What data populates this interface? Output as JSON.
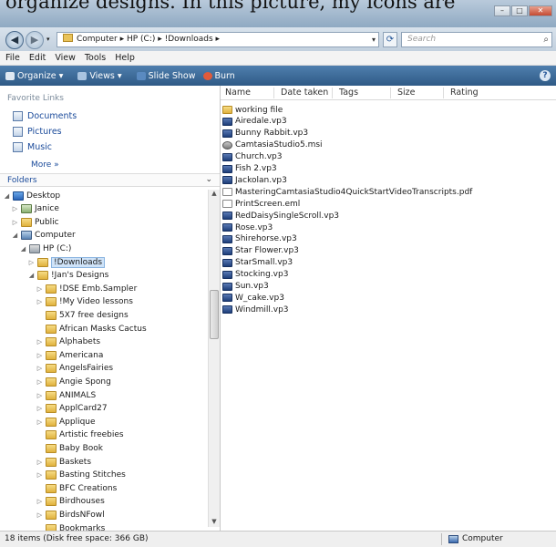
{
  "caption": "organize designs. In this picture, my icons are",
  "address": {
    "breadcrumb": "Computer  ▸  HP (C:)  ▸  !Downloads  ▸",
    "search_placeholder": "Search"
  },
  "menu": [
    "File",
    "Edit",
    "View",
    "Tools",
    "Help"
  ],
  "commands": {
    "organize": "Organize ▾",
    "views": "Views ▾",
    "slideshow": "Slide Show",
    "burn": "Burn"
  },
  "favorites": {
    "title": "Favorite Links",
    "items": [
      "Documents",
      "Pictures",
      "Music"
    ],
    "more": "More »"
  },
  "folders_title": "Folders",
  "tree": [
    {
      "label": "Desktop",
      "icon": "desktop",
      "toggle": "◢"
    },
    {
      "label": "Janice",
      "icon": "user",
      "toggle": "▷"
    },
    {
      "label": "Public",
      "icon": "folder",
      "toggle": "▷"
    },
    {
      "label": "Computer",
      "icon": "computer",
      "toggle": "◢"
    },
    {
      "label": "HP (C:)",
      "icon": "drive",
      "toggle": "◢"
    },
    {
      "label": "!Downloads",
      "icon": "folder",
      "toggle": "▷",
      "selected": true
    },
    {
      "label": "!Jan's Designs",
      "icon": "folder",
      "toggle": "◢"
    },
    {
      "label": "!DSE Emb.Sampler",
      "icon": "folder",
      "toggle": "▷"
    },
    {
      "label": "!My Video lessons",
      "icon": "folder",
      "toggle": "▷"
    },
    {
      "label": "5X7 free designs",
      "icon": "folder",
      "toggle": ""
    },
    {
      "label": "African Masks Cactus",
      "icon": "folder",
      "toggle": ""
    },
    {
      "label": "Alphabets",
      "icon": "folder",
      "toggle": "▷"
    },
    {
      "label": "Americana",
      "icon": "folder",
      "toggle": "▷"
    },
    {
      "label": "AngelsFairies",
      "icon": "folder",
      "toggle": "▷"
    },
    {
      "label": "Angie Spong",
      "icon": "folder",
      "toggle": "▷"
    },
    {
      "label": "ANIMALS",
      "icon": "folder",
      "toggle": "▷"
    },
    {
      "label": "ApplCard27",
      "icon": "folder",
      "toggle": "▷"
    },
    {
      "label": "Applique",
      "icon": "folder",
      "toggle": "▷"
    },
    {
      "label": "Artistic freebies",
      "icon": "folder",
      "toggle": ""
    },
    {
      "label": "Baby Book",
      "icon": "folder",
      "toggle": ""
    },
    {
      "label": "Baskets",
      "icon": "folder",
      "toggle": "▷"
    },
    {
      "label": "Basting Stitches",
      "icon": "folder",
      "toggle": "▷"
    },
    {
      "label": "BFC Creations",
      "icon": "folder",
      "toggle": ""
    },
    {
      "label": "Birdhouses",
      "icon": "folder",
      "toggle": "▷"
    },
    {
      "label": "BirdsNFowl",
      "icon": "folder",
      "toggle": "▷"
    },
    {
      "label": "Bookmarks",
      "icon": "folder",
      "toggle": ""
    }
  ],
  "columns": [
    "Name",
    "Date taken",
    "Tags",
    "Size",
    "Rating"
  ],
  "files": [
    {
      "name": "working file",
      "type": "folder"
    },
    {
      "name": "Airedale.vp3",
      "type": "vp3"
    },
    {
      "name": "Bunny Rabbit.vp3",
      "type": "vp3"
    },
    {
      "name": "CamtasiaStudio5.msi",
      "type": "msi"
    },
    {
      "name": "Church.vp3",
      "type": "vp3"
    },
    {
      "name": "Fish 2.vp3",
      "type": "vp3"
    },
    {
      "name": "Jackolan.vp3",
      "type": "vp3"
    },
    {
      "name": "MasteringCamtasiaStudio4QuickStartVideoTranscripts.pdf",
      "type": "doc"
    },
    {
      "name": "PrintScreen.eml",
      "type": "doc"
    },
    {
      "name": "RedDaisySingleScroll.vp3",
      "type": "vp3"
    },
    {
      "name": "Rose.vp3",
      "type": "vp3"
    },
    {
      "name": "Shirehorse.vp3",
      "type": "vp3"
    },
    {
      "name": "Star Flower.vp3",
      "type": "vp3"
    },
    {
      "name": "StarSmall.vp3",
      "type": "vp3"
    },
    {
      "name": "Stocking.vp3",
      "type": "vp3"
    },
    {
      "name": "Sun.vp3",
      "type": "vp3"
    },
    {
      "name": "W_cake.vp3",
      "type": "vp3"
    },
    {
      "name": "Windmill.vp3",
      "type": "vp3"
    }
  ],
  "status": {
    "left": "18 items (Disk free space: 366 GB)",
    "right": "Computer"
  }
}
